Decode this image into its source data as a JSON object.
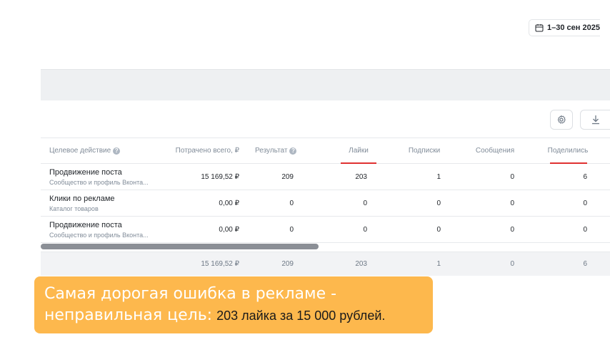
{
  "toolbar": {
    "date_range": "1–30 сен 2025",
    "icons": {
      "calendar": "calendar-icon",
      "settings": "gear-icon",
      "download": "download-icon"
    }
  },
  "table": {
    "columns": {
      "target_action": "Целевое действие",
      "spent": "Потрачено всего, ₽",
      "result": "Результат",
      "likes": "Лайки",
      "subscriptions": "Подписки",
      "messages": "Сообщения",
      "shares": "Поделились"
    },
    "rows": [
      {
        "title": "Продвижение поста",
        "subtitle": "Сообщество и профиль Вконта...",
        "spent": "15 169,52 ₽",
        "result": "209",
        "likes": "203",
        "subscriptions": "1",
        "messages": "0",
        "shares": "6"
      },
      {
        "title": "Клики по рекламе",
        "subtitle": "Каталог товаров",
        "spent": "0,00 ₽",
        "result": "0",
        "likes": "0",
        "subscriptions": "0",
        "messages": "0",
        "shares": "0"
      },
      {
        "title": "Продвижение поста",
        "subtitle": "Сообщество и профиль Вконта...",
        "spent": "0,00 ₽",
        "result": "0",
        "likes": "0",
        "subscriptions": "0",
        "messages": "0",
        "shares": "0"
      }
    ],
    "totals": {
      "spent": "15 169,52 ₽",
      "result": "209",
      "likes": "203",
      "subscriptions": "1",
      "messages": "0",
      "shares": "6"
    },
    "highlight_color": "#e03131"
  },
  "banner": {
    "line1": "Самая дорогая ошибка в рекламе -",
    "line2": "неправильная цель:",
    "accent": "203 лайка за 15 000 рублей.",
    "background": "#fdb84d"
  }
}
